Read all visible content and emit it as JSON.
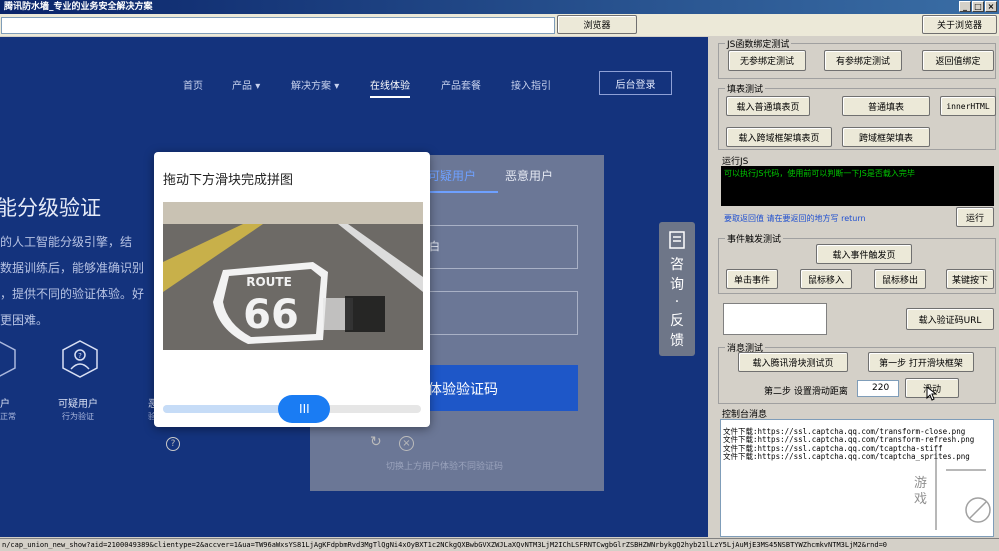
{
  "window": {
    "title": "腾讯防水墙_专业的业务安全解决方案"
  },
  "toolbar": {
    "url_value": "",
    "browse_label": "浏览器",
    "about_label": "关于浏览器"
  },
  "web": {
    "nav": [
      "首页",
      "产品",
      "解决方案",
      "在线体验",
      "产品套餐",
      "接入指引"
    ],
    "login_label": "后台登录",
    "hero_title": "能分级验证",
    "hero_lines": [
      "的人工智能分级引擎，结",
      "数据训练后，能够准确识别",
      "，提供不同的验证体验。好",
      "更困难。"
    ],
    "features": [
      {
        "label": "户",
        "sub": "正常"
      },
      {
        "label": "可疑用户",
        "sub": "行为验证"
      },
      {
        "label": "恶",
        "sub": "验"
      }
    ],
    "tabs": [
      "可疑用户",
      "恶意用户"
    ],
    "field1_placeholder": "白",
    "submit_label": "体验验证码",
    "panel_hint": "切换上方用户体验不同验证码",
    "consult_label": [
      "咨",
      "询",
      "·",
      "反",
      "馈"
    ]
  },
  "captcha": {
    "title": "拖动下方滑块完成拼图",
    "slider_progress": 0.56,
    "route_text": "ROUTE",
    "route_number": "66"
  },
  "js_binding": {
    "group_title": "JS函数绑定测试",
    "buttons": [
      "无参绑定测试",
      "有参绑定测试",
      "返回值绑定"
    ]
  },
  "form_test": {
    "group_title": "填表测试",
    "buttons": [
      "载入普通填表页",
      "普通填表",
      "innerHTML",
      "载入跨域框架填表页",
      "跨域框架填表"
    ]
  },
  "run_js": {
    "group_title": "运行JS",
    "code_text": "可以执行JS代码，使用前可以判断一下JS是否载入完毕",
    "hint_text": "要取返回值 请在要返回的地方写 return",
    "run_label": "运行"
  },
  "event_test": {
    "group_title": "事件触发测试",
    "load_label": "载入事件触发页",
    "buttons": [
      "单击事件",
      "鼠标移入",
      "鼠标移出",
      "某键按下"
    ]
  },
  "captcha_img": {
    "load_label": "载入验证码URL"
  },
  "message_test": {
    "group_title": "消息测试",
    "load_label": "载入腾讯滑块测试页",
    "step1_label": "第一步 打开滑块框架",
    "step2_label": "第二步 设置滑动距离",
    "distance_value": "220",
    "slide_label": "滑动"
  },
  "console": {
    "title": "控制台消息",
    "lines": [
      "文件下载:https://ssl.captcha.qq.com/transform-close.png",
      "文件下载:https://ssl.captcha.qq.com/transform-refresh.png",
      "文件下载:https://ssl.captcha.qq.com/tcaptcha-stiff",
      "文件下载:https://ssl.captcha.qq.com/tcaptcha_sprites.png"
    ]
  },
  "watermark": {
    "text": "游戏"
  },
  "status": {
    "text": "n/cap_union_new_show?aid=2100049389&clientype=2&accver=1&ua=TW96aWxsYS81LjAgKFdpbmRvd3MgTlQgNi4xOyBXT1c2NCkgQXBwbGVXZWJLaXQvNTM3LjM2IChLSFRNTCwgbGlrZSBHZWNrbykgQ2hyb21lLzY5LjAuMjE3MS45NSBTYWZhcmkvNTM3LjM2&rnd=0"
  },
  "colors": {
    "web_bg": "#14337d",
    "slider_blue": "#1a7cf3",
    "submit_blue": "#1e57c8",
    "code_green": "#00c800"
  }
}
